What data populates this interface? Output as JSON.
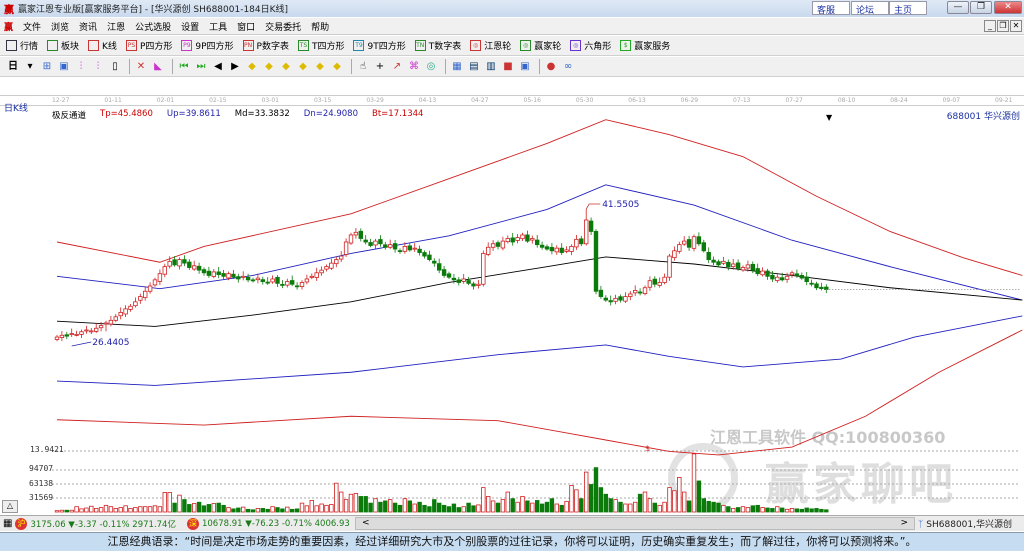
{
  "window": {
    "title": "赢家江恩专业版[赢家服务平台] - [华兴源创  SH688001-184日K线]",
    "links": [
      "客服",
      "论坛",
      "主页"
    ],
    "logo": "赢"
  },
  "menu": [
    "文件",
    "浏览",
    "资讯",
    "江恩",
    "公式选股",
    "设置",
    "工具",
    "窗口",
    "交易委托",
    "帮助"
  ],
  "toolbar1": [
    {
      "label": "行情",
      "icon": "grid-icon",
      "color": "#334"
    },
    {
      "label": "板块",
      "icon": "blocks-icon",
      "color": "#2a8a2a"
    },
    {
      "label": "K线",
      "icon": "candles-icon",
      "color": "#c33"
    },
    {
      "label": "P四方形",
      "icon": "p4-icon",
      "tag": "PS",
      "color": "#c33"
    },
    {
      "label": "9P四方形",
      "icon": "9p4-icon",
      "tag": "P9",
      "color": "#c3c"
    },
    {
      "label": "P数字表",
      "icon": "pn-icon",
      "tag": "PN",
      "color": "#c33"
    },
    {
      "label": "T四方形",
      "icon": "t4-icon",
      "tag": "TS",
      "color": "#2a8a2a"
    },
    {
      "label": "9T四方形",
      "icon": "9t4-icon",
      "tag": "T9",
      "color": "#28a"
    },
    {
      "label": "T数字表",
      "icon": "tn-icon",
      "tag": "TN",
      "color": "#2a8a2a"
    },
    {
      "label": "江恩轮",
      "icon": "gann-wheel-icon",
      "tag": "◎",
      "color": "#c33"
    },
    {
      "label": "赢家轮",
      "icon": "winner-wheel-icon",
      "tag": "◎",
      "color": "#2a8a2a"
    },
    {
      "label": "六角形",
      "icon": "hexagon-icon",
      "tag": "◎",
      "color": "#63c"
    },
    {
      "label": "赢家服务",
      "icon": "dollar-icon",
      "tag": "$",
      "color": "#2a2"
    }
  ],
  "toolbar2": {
    "period": "日",
    "dropdown": "▾"
  },
  "axis": {
    "dates": [
      "12-27",
      "01-11",
      "02-01",
      "02-15",
      "03-01",
      "03-15",
      "03-29",
      "04-13",
      "04-27",
      "05-16",
      "05-30",
      "06-13",
      "06-29",
      "07-13",
      "07-27",
      "08-10",
      "08-24",
      "09-07",
      "09-21"
    ]
  },
  "chart_header": {
    "period_label": "日K线",
    "indicator": "极反通道",
    "tp": "Tp=45.4860",
    "up": "Up=39.8611",
    "md": "Md=33.3832",
    "dn": "Dn=24.9080",
    "bt": "Bt=17.1344",
    "code": "688001  华兴源创"
  },
  "chart_data": {
    "type": "candlestick",
    "colors": {
      "up": "#d02020",
      "down": "#0a7a0a",
      "top": "#d02020",
      "upper": "#2020c0",
      "mid": "#000000",
      "lower": "#2020c0",
      "bottom": "#d02020"
    },
    "high_label": "41.5505",
    "low_label": "26.4405",
    "high_value": 41.5505,
    "low_value": 26.4405,
    "closes": [
      27.0,
      27.2,
      27.1,
      27.4,
      27.3,
      27.6,
      27.8,
      27.7,
      28.0,
      28.3,
      28.6,
      28.9,
      29.3,
      29.8,
      30.2,
      30.5,
      31.0,
      31.6,
      32.2,
      32.8,
      33.5,
      34.2,
      35.0,
      35.6,
      35.2,
      35.8,
      35.4,
      34.9,
      35.1,
      34.6,
      34.3,
      34.0,
      34.4,
      34.1,
      33.9,
      34.2,
      33.8,
      33.6,
      33.9,
      33.5,
      33.4,
      33.7,
      33.3,
      33.2,
      33.6,
      33.1,
      32.9,
      33.3,
      33.0,
      32.8,
      33.2,
      33.6,
      33.9,
      34.3,
      34.6,
      35.0,
      35.4,
      35.8,
      36.2,
      37.8,
      38.6,
      38.9,
      38.2,
      37.8,
      37.4,
      37.9,
      37.6,
      37.2,
      37.5,
      37.0,
      36.8,
      37.3,
      36.9,
      37.1,
      36.6,
      36.2,
      35.8,
      35.4,
      34.6,
      34.0,
      33.8,
      33.5,
      33.2,
      33.6,
      33.1,
      32.8,
      33.0,
      36.5,
      37.2,
      37.6,
      37.3,
      37.9,
      38.2,
      37.8,
      38.3,
      38.6,
      37.9,
      38.2,
      37.5,
      37.2,
      37.0,
      36.8,
      37.1,
      36.6,
      36.9,
      37.3,
      38.1,
      37.6,
      40.3,
      39.0,
      32.2,
      31.6,
      31.2,
      31.0,
      31.4,
      31.2,
      31.6,
      31.9,
      32.3,
      32.0,
      32.6,
      33.4,
      33.0,
      33.2,
      33.8,
      36.2,
      36.8,
      37.5,
      37.9,
      37.2,
      38.4,
      37.6,
      36.8,
      35.8,
      35.5,
      35.2,
      35.6,
      35.0,
      35.3,
      34.8,
      34.9,
      35.2,
      34.6,
      34.2,
      34.5,
      33.9,
      33.6,
      33.8,
      33.5,
      33.9,
      34.3,
      34.0,
      33.7,
      33.3,
      33.1,
      32.6,
      32.5,
      32.4
    ],
    "volumes": [
      3000,
      4000,
      4000,
      4000,
      12000,
      7000,
      9000,
      13000,
      8000,
      10000,
      15000,
      12000,
      8000,
      10000,
      14000,
      8000,
      10000,
      12000,
      12000,
      12000,
      14000,
      12000,
      44000,
      44000,
      20000,
      38000,
      28000,
      17000,
      19000,
      22000,
      14000,
      17000,
      19000,
      20000,
      15000,
      10000,
      7000,
      9000,
      11000,
      6000,
      5000,
      8000,
      8000,
      6000,
      12000,
      10000,
      7000,
      11000,
      6000,
      7000,
      20000,
      14000,
      26000,
      14000,
      18000,
      15000,
      17000,
      65000,
      45000,
      28000,
      40000,
      42000,
      35000,
      35000,
      20000,
      30000,
      22000,
      25000,
      28000,
      20000,
      15000,
      30000,
      25000,
      18000,
      22000,
      15000,
      12000,
      28000,
      20000,
      15000,
      12000,
      18000,
      10000,
      12000,
      20000,
      14000,
      16000,
      55000,
      35000,
      25000,
      20000,
      28000,
      45000,
      30000,
      22000,
      35000,
      25000,
      20000,
      26000,
      18000,
      22000,
      30000,
      18000,
      15000,
      24000,
      60000,
      50000,
      30000,
      90000,
      62000,
      100000,
      55000,
      40000,
      30000,
      28000,
      22000,
      18000,
      18000,
      22000,
      40000,
      45000,
      30000,
      20000,
      15000,
      22000,
      55000,
      48000,
      78000,
      45000,
      25000,
      131000,
      70000,
      30000,
      24000,
      22000,
      20000,
      15000,
      12000,
      8000,
      10000,
      12000,
      10000,
      14000,
      15000,
      10000,
      9000,
      8000,
      12000,
      9000,
      6000,
      8000,
      7000,
      6000,
      9000,
      7000,
      8000,
      6000,
      5000
    ],
    "channels": {
      "top": [
        [
          0,
          37.8
        ],
        [
          21,
          35.5
        ],
        [
          30,
          37.3
        ],
        [
          60,
          41
        ],
        [
          80,
          45
        ],
        [
          100,
          49
        ],
        [
          112,
          51.7
        ],
        [
          125,
          50
        ],
        [
          140,
          47.5
        ],
        [
          155,
          43
        ],
        [
          170,
          39
        ],
        [
          185,
          36
        ],
        [
          197,
          34
        ]
      ],
      "upper": [
        [
          0,
          33.9
        ],
        [
          21,
          32.5
        ],
        [
          40,
          34
        ],
        [
          60,
          36.5
        ],
        [
          80,
          38.5
        ],
        [
          100,
          41.5
        ],
        [
          112,
          44.3
        ],
        [
          130,
          42
        ],
        [
          150,
          38
        ],
        [
          170,
          35
        ],
        [
          197,
          31.2
        ]
      ],
      "mid": [
        [
          0,
          28.8
        ],
        [
          20,
          28.2
        ],
        [
          40,
          29.5
        ],
        [
          60,
          31
        ],
        [
          80,
          33.2
        ],
        [
          100,
          35
        ],
        [
          112,
          36.1
        ],
        [
          130,
          35.3
        ],
        [
          150,
          34
        ],
        [
          170,
          32.6
        ],
        [
          197,
          31.2
        ]
      ],
      "lower": [
        [
          0,
          22
        ],
        [
          20,
          21.5
        ],
        [
          60,
          23
        ],
        [
          90,
          25
        ],
        [
          112,
          26.1
        ],
        [
          125,
          24.8
        ],
        [
          140,
          23.6
        ],
        [
          160,
          24.5
        ],
        [
          175,
          27
        ],
        [
          197,
          29.4
        ]
      ],
      "bottom": [
        [
          0,
          17.6
        ],
        [
          30,
          17
        ],
        [
          60,
          18
        ],
        [
          90,
          17.5
        ],
        [
          105,
          16
        ],
        [
          112,
          15.3
        ],
        [
          125,
          14
        ],
        [
          135,
          13.6
        ],
        [
          150,
          14.5
        ],
        [
          165,
          18
        ],
        [
          180,
          23
        ],
        [
          197,
          27.8
        ]
      ]
    },
    "y_labels": {
      "price": "13.9421",
      "vol": [
        "94707",
        "63138",
        "31569"
      ]
    },
    "vol_ticks": [
      94707,
      63138,
      31569
    ]
  },
  "watermark": {
    "line1": "江恩工具软件  QQ:100800360",
    "line2": "赢家聊吧"
  },
  "status": {
    "sh_icon": "沪",
    "sh": "3175.06 ▼-3.37 -0.11% 2971.74亿",
    "sz_icon": "深",
    "sz": "10678.91 ▼-76.23 -0.71% 4006.93",
    "scroll_left": "<",
    "scroll_right": ">",
    "stock": "SH688001,华兴源创"
  },
  "quote": "江恩经典语录：“时间是决定市场走势的重要因素，经过详细研究大市及个别股票的过往记录，你将可以证明，历史确实重复发生；而了解过往，你将可以预测将来。”。"
}
